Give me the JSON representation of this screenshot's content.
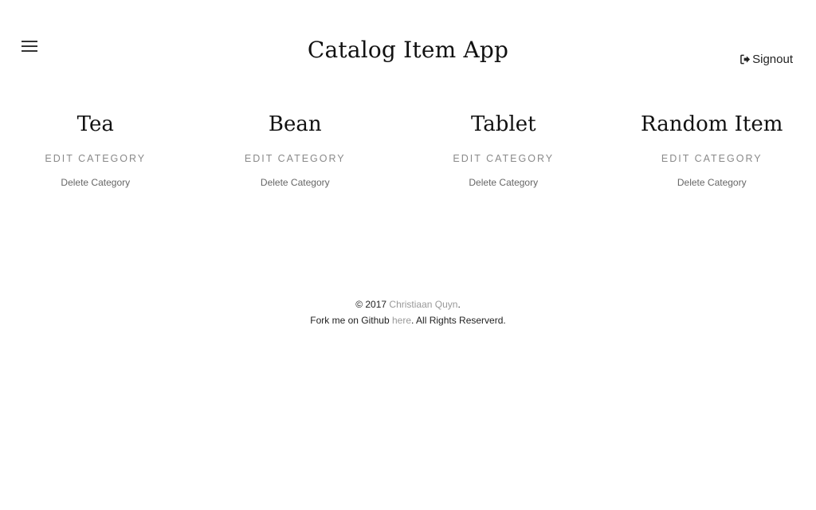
{
  "header": {
    "menu_icon": "hamburger-menu-icon",
    "title": "Catalog Item App",
    "signout_icon": "sign-out-icon",
    "signout_label": "Signout"
  },
  "categories": [
    {
      "name": "Tea",
      "edit_label": "EDIT CATEGORY",
      "delete_label": "Delete Category"
    },
    {
      "name": "Bean",
      "edit_label": "EDIT CATEGORY",
      "delete_label": "Delete Category"
    },
    {
      "name": "Tablet",
      "edit_label": "EDIT CATEGORY",
      "delete_label": "Delete Category"
    },
    {
      "name": "Random Item",
      "edit_label": "EDIT CATEGORY",
      "delete_label": "Delete Category"
    }
  ],
  "footer": {
    "copyright_prefix": "© 2017 ",
    "author_link": "Christiaan Quyn",
    "copyright_suffix": ".",
    "fork_prefix": "Fork me on Github ",
    "github_link": "here",
    "fork_suffix": ". All Rights Reserverd."
  },
  "colors": {
    "muted_link": "#999999",
    "text": "#222222"
  }
}
